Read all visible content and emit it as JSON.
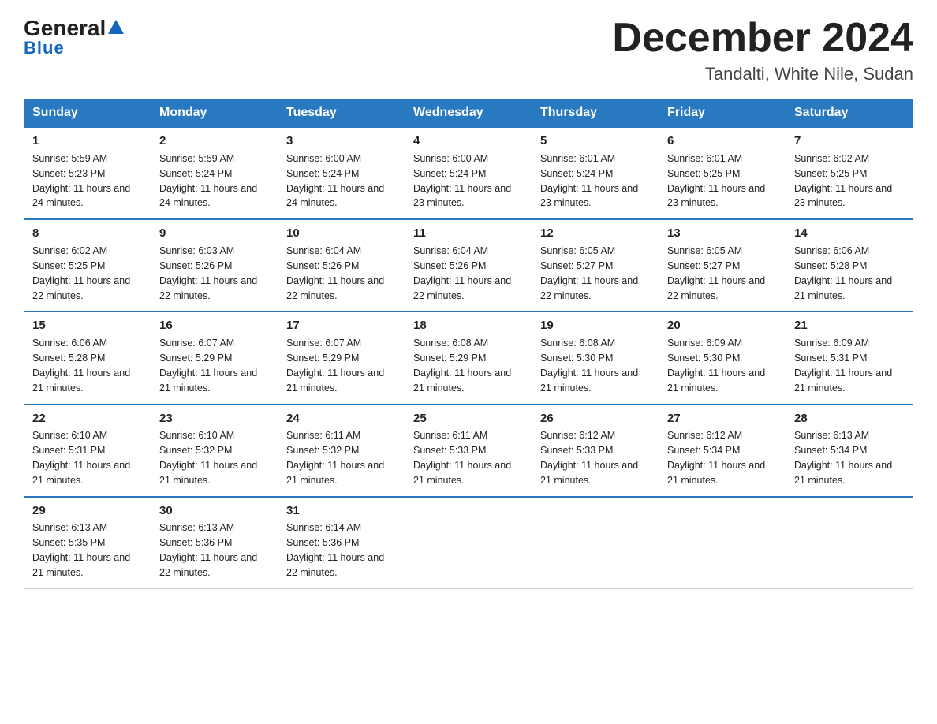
{
  "header": {
    "logo_general": "General",
    "logo_blue": "Blue",
    "month_title": "December 2024",
    "location": "Tandalti, White Nile, Sudan"
  },
  "weekdays": [
    "Sunday",
    "Monday",
    "Tuesday",
    "Wednesday",
    "Thursday",
    "Friday",
    "Saturday"
  ],
  "weeks": [
    [
      {
        "day": "1",
        "sunrise": "5:59 AM",
        "sunset": "5:23 PM",
        "daylight": "11 hours and 24 minutes."
      },
      {
        "day": "2",
        "sunrise": "5:59 AM",
        "sunset": "5:24 PM",
        "daylight": "11 hours and 24 minutes."
      },
      {
        "day": "3",
        "sunrise": "6:00 AM",
        "sunset": "5:24 PM",
        "daylight": "11 hours and 24 minutes."
      },
      {
        "day": "4",
        "sunrise": "6:00 AM",
        "sunset": "5:24 PM",
        "daylight": "11 hours and 23 minutes."
      },
      {
        "day": "5",
        "sunrise": "6:01 AM",
        "sunset": "5:24 PM",
        "daylight": "11 hours and 23 minutes."
      },
      {
        "day": "6",
        "sunrise": "6:01 AM",
        "sunset": "5:25 PM",
        "daylight": "11 hours and 23 minutes."
      },
      {
        "day": "7",
        "sunrise": "6:02 AM",
        "sunset": "5:25 PM",
        "daylight": "11 hours and 23 minutes."
      }
    ],
    [
      {
        "day": "8",
        "sunrise": "6:02 AM",
        "sunset": "5:25 PM",
        "daylight": "11 hours and 22 minutes."
      },
      {
        "day": "9",
        "sunrise": "6:03 AM",
        "sunset": "5:26 PM",
        "daylight": "11 hours and 22 minutes."
      },
      {
        "day": "10",
        "sunrise": "6:04 AM",
        "sunset": "5:26 PM",
        "daylight": "11 hours and 22 minutes."
      },
      {
        "day": "11",
        "sunrise": "6:04 AM",
        "sunset": "5:26 PM",
        "daylight": "11 hours and 22 minutes."
      },
      {
        "day": "12",
        "sunrise": "6:05 AM",
        "sunset": "5:27 PM",
        "daylight": "11 hours and 22 minutes."
      },
      {
        "day": "13",
        "sunrise": "6:05 AM",
        "sunset": "5:27 PM",
        "daylight": "11 hours and 22 minutes."
      },
      {
        "day": "14",
        "sunrise": "6:06 AM",
        "sunset": "5:28 PM",
        "daylight": "11 hours and 21 minutes."
      }
    ],
    [
      {
        "day": "15",
        "sunrise": "6:06 AM",
        "sunset": "5:28 PM",
        "daylight": "11 hours and 21 minutes."
      },
      {
        "day": "16",
        "sunrise": "6:07 AM",
        "sunset": "5:29 PM",
        "daylight": "11 hours and 21 minutes."
      },
      {
        "day": "17",
        "sunrise": "6:07 AM",
        "sunset": "5:29 PM",
        "daylight": "11 hours and 21 minutes."
      },
      {
        "day": "18",
        "sunrise": "6:08 AM",
        "sunset": "5:29 PM",
        "daylight": "11 hours and 21 minutes."
      },
      {
        "day": "19",
        "sunrise": "6:08 AM",
        "sunset": "5:30 PM",
        "daylight": "11 hours and 21 minutes."
      },
      {
        "day": "20",
        "sunrise": "6:09 AM",
        "sunset": "5:30 PM",
        "daylight": "11 hours and 21 minutes."
      },
      {
        "day": "21",
        "sunrise": "6:09 AM",
        "sunset": "5:31 PM",
        "daylight": "11 hours and 21 minutes."
      }
    ],
    [
      {
        "day": "22",
        "sunrise": "6:10 AM",
        "sunset": "5:31 PM",
        "daylight": "11 hours and 21 minutes."
      },
      {
        "day": "23",
        "sunrise": "6:10 AM",
        "sunset": "5:32 PM",
        "daylight": "11 hours and 21 minutes."
      },
      {
        "day": "24",
        "sunrise": "6:11 AM",
        "sunset": "5:32 PM",
        "daylight": "11 hours and 21 minutes."
      },
      {
        "day": "25",
        "sunrise": "6:11 AM",
        "sunset": "5:33 PM",
        "daylight": "11 hours and 21 minutes."
      },
      {
        "day": "26",
        "sunrise": "6:12 AM",
        "sunset": "5:33 PM",
        "daylight": "11 hours and 21 minutes."
      },
      {
        "day": "27",
        "sunrise": "6:12 AM",
        "sunset": "5:34 PM",
        "daylight": "11 hours and 21 minutes."
      },
      {
        "day": "28",
        "sunrise": "6:13 AM",
        "sunset": "5:34 PM",
        "daylight": "11 hours and 21 minutes."
      }
    ],
    [
      {
        "day": "29",
        "sunrise": "6:13 AM",
        "sunset": "5:35 PM",
        "daylight": "11 hours and 21 minutes."
      },
      {
        "day": "30",
        "sunrise": "6:13 AM",
        "sunset": "5:36 PM",
        "daylight": "11 hours and 22 minutes."
      },
      {
        "day": "31",
        "sunrise": "6:14 AM",
        "sunset": "5:36 PM",
        "daylight": "11 hours and 22 minutes."
      },
      null,
      null,
      null,
      null
    ]
  ]
}
